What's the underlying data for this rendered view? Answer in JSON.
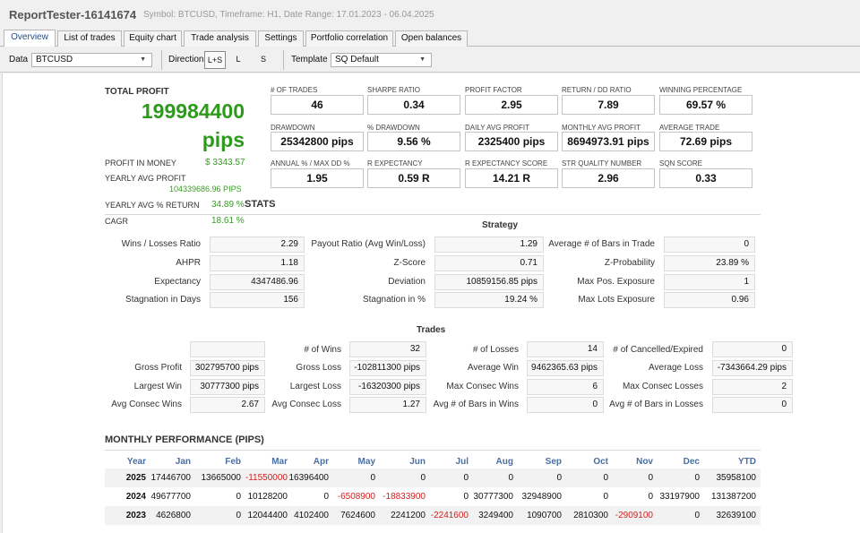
{
  "window": {
    "title": "ReportTester-16141674",
    "subtitle": "Symbol: BTCUSD, Timeframe: H1, Date Range: 17.01.2023 - 06.04.2025"
  },
  "tabs": [
    "Overview",
    "List of trades",
    "Equity chart",
    "Trade analysis",
    "Settings",
    "Portfolio correlation",
    "Open balances"
  ],
  "toolbar": {
    "data_label": "Data",
    "data_value": "BTCUSD",
    "direction_label": "Direction",
    "directions": [
      "L+S",
      "L",
      "S"
    ],
    "template_label": "Template",
    "template_value": "SQ Default"
  },
  "summary": {
    "total_profit_label": "TOTAL PROFIT",
    "total_profit_value": "199984400",
    "total_profit_unit": "pips",
    "items": [
      {
        "label": "PROFIT IN MONEY",
        "value": "$ 3343.57"
      },
      {
        "label": "YEARLY AVG PROFIT",
        "value": "104339686.96 PIPS"
      },
      {
        "label": "YEARLY AVG % RETURN",
        "value": "34.89 %"
      },
      {
        "label": "CAGR",
        "value": "18.61 %"
      }
    ]
  },
  "stats": [
    {
      "label": "# OF TRADES",
      "value": "46"
    },
    {
      "label": "SHARPE RATIO",
      "value": "0.34"
    },
    {
      "label": "PROFIT FACTOR",
      "value": "2.95"
    },
    {
      "label": "RETURN / DD RATIO",
      "value": "7.89"
    },
    {
      "label": "WINNING PERCENTAGE",
      "value": "69.57 %"
    },
    {
      "label": "DRAWDOWN",
      "value": "25342800 pips"
    },
    {
      "label": "% DRAWDOWN",
      "value": "9.56 %"
    },
    {
      "label": "DAILY AVG PROFIT",
      "value": "2325400 pips"
    },
    {
      "label": "MONTHLY AVG PROFIT",
      "value": "8694973.91 pips"
    },
    {
      "label": "AVERAGE TRADE",
      "value": "72.69 pips"
    },
    {
      "label": "ANNUAL % / MAX DD %",
      "value": "1.95"
    },
    {
      "label": "R EXPECTANCY",
      "value": "0.59 R"
    },
    {
      "label": "R EXPECTANCY SCORE",
      "value": "14.21 R"
    },
    {
      "label": "STR QUALITY NUMBER",
      "value": "2.96"
    },
    {
      "label": "SQN SCORE",
      "value": "0.33"
    }
  ],
  "stats_section_title": "STATS",
  "strategy": {
    "title": "Strategy",
    "rows": [
      [
        {
          "label": "Wins / Losses Ratio",
          "value": "2.29"
        },
        {
          "label": "Payout Ratio (Avg Win/Loss)",
          "value": "1.29"
        },
        {
          "label": "Average # of Bars in Trade",
          "value": "0"
        }
      ],
      [
        {
          "label": "AHPR",
          "value": "1.18"
        },
        {
          "label": "Z-Score",
          "value": "0.71"
        },
        {
          "label": "Z-Probability",
          "value": "23.89 %"
        }
      ],
      [
        {
          "label": "Expectancy",
          "value": "4347486.96"
        },
        {
          "label": "Deviation",
          "value": "10859156.85 pips"
        },
        {
          "label": "Max Pos. Exposure",
          "value": "1"
        }
      ],
      [
        {
          "label": "Stagnation in Days",
          "value": "156"
        },
        {
          "label": "Stagnation in %",
          "value": "19.24 %"
        },
        {
          "label": "Max Lots Exposure",
          "value": "0.96"
        }
      ]
    ]
  },
  "trades": {
    "title": "Trades",
    "rows": [
      [
        {
          "label": "",
          "value": ""
        },
        {
          "label": "# of Wins",
          "value": "32"
        },
        {
          "label": "# of Losses",
          "value": "14"
        },
        {
          "label": "# of Cancelled/Expired",
          "value": "0"
        }
      ],
      [
        {
          "label": "Gross Profit",
          "value": "302795700 pips"
        },
        {
          "label": "Gross Loss",
          "value": "-102811300 pips"
        },
        {
          "label": "Average Win",
          "value": "9462365.63 pips"
        },
        {
          "label": "Average Loss",
          "value": "-7343664.29 pips"
        }
      ],
      [
        {
          "label": "Largest Win",
          "value": "30777300 pips"
        },
        {
          "label": "Largest Loss",
          "value": "-16320300 pips"
        },
        {
          "label": "Max Consec Wins",
          "value": "6"
        },
        {
          "label": "Max Consec Losses",
          "value": "2"
        }
      ],
      [
        {
          "label": "Avg Consec Wins",
          "value": "2.67"
        },
        {
          "label": "Avg Consec Loss",
          "value": "1.27"
        },
        {
          "label": "Avg # of Bars in Wins",
          "value": "0"
        },
        {
          "label": "Avg # of Bars in Losses",
          "value": "0"
        }
      ]
    ]
  },
  "monthly": {
    "title": "MONTHLY PERFORMANCE (PIPS)",
    "headers": [
      "Year",
      "Jan",
      "Feb",
      "Mar",
      "Apr",
      "May",
      "Jun",
      "Jul",
      "Aug",
      "Sep",
      "Oct",
      "Nov",
      "Dec",
      "YTD"
    ],
    "rows": [
      [
        "2025",
        "17446700",
        "13665000",
        "-11550000",
        "16396400",
        "0",
        "0",
        "0",
        "0",
        "0",
        "0",
        "0",
        "0",
        "35958100"
      ],
      [
        "2024",
        "49677700",
        "0",
        "10128200",
        "0",
        "-6508900",
        "-18833900",
        "0",
        "30777300",
        "32948900",
        "0",
        "0",
        "33197900",
        "131387200"
      ],
      [
        "2023",
        "4626800",
        "0",
        "12044400",
        "4102400",
        "7624600",
        "2241200",
        "-2241600",
        "3249400",
        "1090700",
        "2810300",
        "-2909100",
        "0",
        "32639100"
      ]
    ]
  },
  "colors": {
    "profit_green": "#2d9a1c",
    "negative_red": "#d22020",
    "header_blue": "#4a6fa0"
  }
}
